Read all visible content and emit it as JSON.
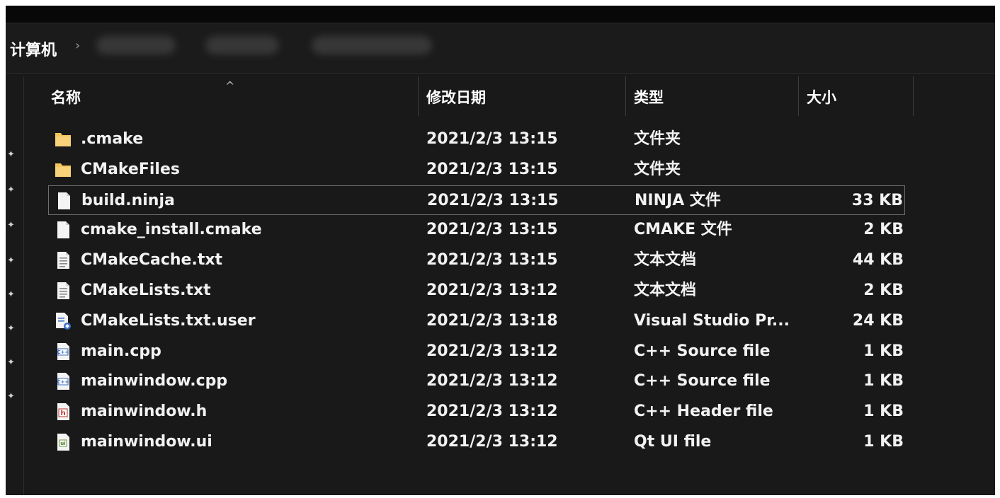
{
  "breadcrumb": {
    "root": "计算机",
    "separator": "›"
  },
  "header": {
    "sort_indicator": "^",
    "col_name": "名称",
    "col_date": "修改日期",
    "col_type": "类型",
    "col_size": "大小"
  },
  "files": [
    {
      "name": ".cmake",
      "date": "2021/2/3 13:15",
      "type": "文件夹",
      "size": "",
      "icon": "folder-icon"
    },
    {
      "name": "CMakeFiles",
      "date": "2021/2/3 13:15",
      "type": "文件夹",
      "size": "",
      "icon": "folder-icon"
    },
    {
      "name": "build.ninja",
      "date": "2021/2/3 13:15",
      "type": "NINJA 文件",
      "size": "33 KB",
      "icon": "blank-file-icon"
    },
    {
      "name": "cmake_install.cmake",
      "date": "2021/2/3 13:15",
      "type": "CMAKE 文件",
      "size": "2 KB",
      "icon": "blank-file-icon"
    },
    {
      "name": "CMakeCache.txt",
      "date": "2021/2/3 13:15",
      "type": "文本文档",
      "size": "44 KB",
      "icon": "text-file-icon"
    },
    {
      "name": "CMakeLists.txt",
      "date": "2021/2/3 13:12",
      "type": "文本文档",
      "size": "2 KB",
      "icon": "text-file-icon"
    },
    {
      "name": "CMakeLists.txt.user",
      "date": "2021/2/3 13:18",
      "type": "Visual Studio Pr...",
      "size": "24 KB",
      "icon": "vs-project-file-icon"
    },
    {
      "name": "main.cpp",
      "date": "2021/2/3 13:12",
      "type": "C++ Source file",
      "size": "1 KB",
      "icon": "cpp-file-icon"
    },
    {
      "name": "mainwindow.cpp",
      "date": "2021/2/3 13:12",
      "type": "C++ Source file",
      "size": "1 KB",
      "icon": "cpp-file-icon"
    },
    {
      "name": "mainwindow.h",
      "date": "2021/2/3 13:12",
      "type": "C++ Header file",
      "size": "1 KB",
      "icon": "header-file-icon"
    },
    {
      "name": "mainwindow.ui",
      "date": "2021/2/3 13:12",
      "type": "Qt UI file",
      "size": "1 KB",
      "icon": "qt-ui-file-icon"
    }
  ],
  "selected_index": 2,
  "colors": {
    "background": "#191919",
    "folder": "#f6c65b",
    "cpp_accent": "#3a6fc4",
    "header_accent": "#b5372f"
  }
}
